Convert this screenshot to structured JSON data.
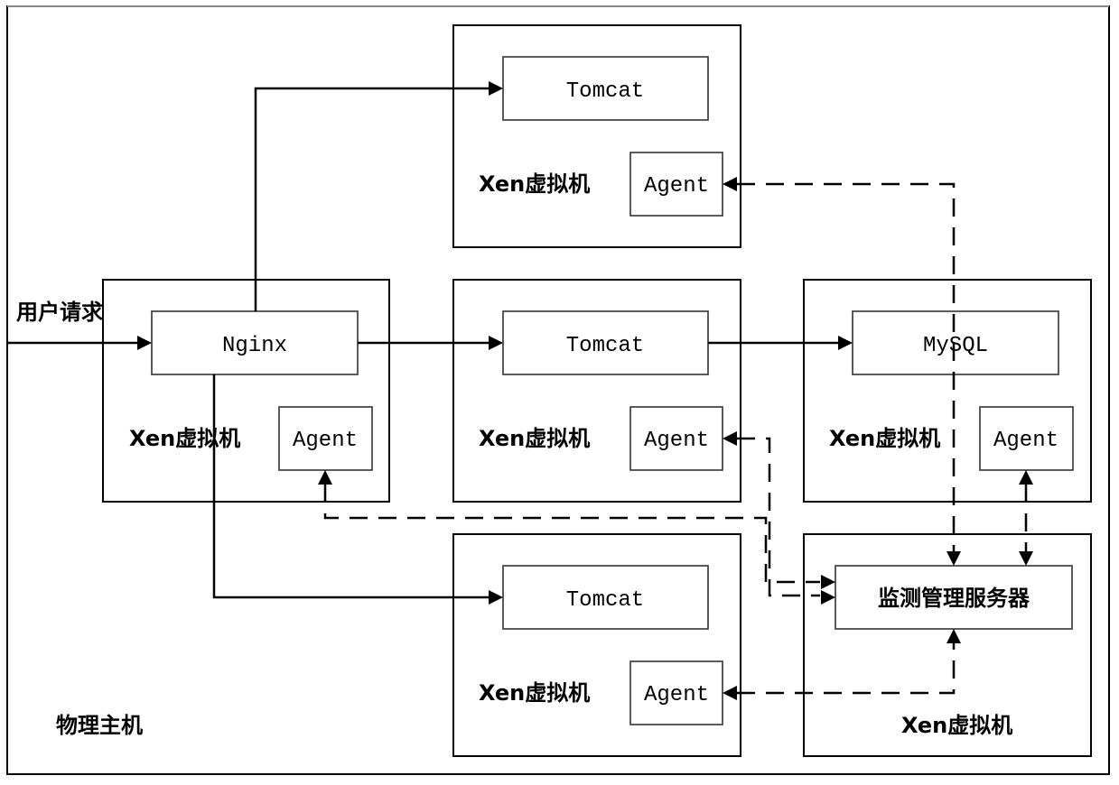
{
  "diagram": {
    "host_label": "物理主机",
    "user_request_label": "用户请求",
    "vms": [
      {
        "id": "vm-nginx",
        "vm_label": "Xen虚拟机",
        "service": "Nginx",
        "agent": "Agent"
      },
      {
        "id": "vm-tomcat-top",
        "vm_label": "Xen虚拟机",
        "service": "Tomcat",
        "agent": "Agent"
      },
      {
        "id": "vm-tomcat-mid",
        "vm_label": "Xen虚拟机",
        "service": "Tomcat",
        "agent": "Agent"
      },
      {
        "id": "vm-tomcat-bottom",
        "vm_label": "Xen虚拟机",
        "service": "Tomcat",
        "agent": "Agent"
      },
      {
        "id": "vm-mysql",
        "vm_label": "Xen虚拟机",
        "service": "MySQL",
        "agent": "Agent"
      },
      {
        "id": "vm-monitor",
        "vm_label": "Xen虚拟机",
        "service": "监测管理服务器"
      }
    ],
    "edges": [
      {
        "from": "user",
        "to": "Nginx",
        "style": "solid"
      },
      {
        "from": "Nginx",
        "to": "Tomcat (top)",
        "style": "solid"
      },
      {
        "from": "Nginx",
        "to": "Tomcat (middle)",
        "style": "solid"
      },
      {
        "from": "Nginx",
        "to": "Tomcat (bottom)",
        "style": "solid"
      },
      {
        "from": "Tomcat (middle)",
        "to": "MySQL",
        "style": "solid"
      },
      {
        "from": "监测管理服务器",
        "to": "Agent (Tomcat top)",
        "style": "dashed",
        "bidirectional": true
      },
      {
        "from": "监测管理服务器",
        "to": "Agent (Tomcat middle)",
        "style": "dashed",
        "bidirectional": true
      },
      {
        "from": "监测管理服务器",
        "to": "Agent (Nginx)",
        "style": "dashed",
        "bidirectional": true
      },
      {
        "from": "监测管理服务器",
        "to": "Agent (MySQL)",
        "style": "dashed",
        "bidirectional": true
      },
      {
        "from": "监测管理服务器",
        "to": "Agent (Tomcat bottom)",
        "style": "dashed",
        "bidirectional": true
      }
    ]
  }
}
